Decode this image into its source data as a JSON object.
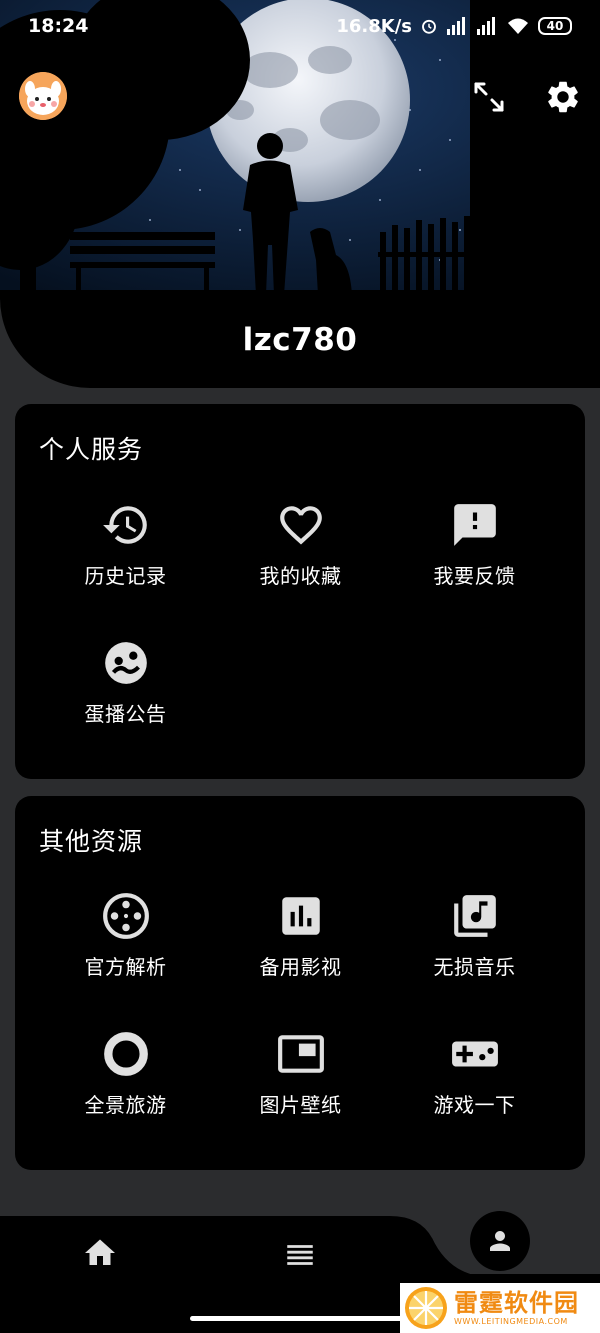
{
  "status_bar": {
    "time": "18:24",
    "network_speed": "16.8K/s",
    "battery_level": "40"
  },
  "profile": {
    "username": "lzc780"
  },
  "sections": [
    {
      "title": "个人服务",
      "items": [
        {
          "label": "历史记录",
          "icon": "history-icon"
        },
        {
          "label": "我的收藏",
          "icon": "heart-icon"
        },
        {
          "label": "我要反馈",
          "icon": "feedback-icon"
        },
        {
          "label": "蛋播公告",
          "icon": "announcement-icon"
        }
      ]
    },
    {
      "title": "其他资源",
      "items": [
        {
          "label": "官方解析",
          "icon": "film-reel-icon"
        },
        {
          "label": "备用影视",
          "icon": "bar-chart-icon"
        },
        {
          "label": "无损音乐",
          "icon": "music-library-icon"
        },
        {
          "label": "全景旅游",
          "icon": "panorama-circle-icon"
        },
        {
          "label": "图片壁纸",
          "icon": "picture-in-picture-icon"
        },
        {
          "label": "游戏一下",
          "icon": "gamepad-icon"
        }
      ]
    }
  ],
  "bottom_nav": {
    "items": [
      "home-icon",
      "list-icon",
      "person-icon"
    ]
  },
  "watermark": {
    "title": "雷霆软件园",
    "subtitle": "WWW.LEITINGMEDIA.COM"
  },
  "colors": {
    "background": "#2b2c2e",
    "card": "#000000",
    "icon": "#e0e0e0",
    "watermark": "#f08a12"
  }
}
